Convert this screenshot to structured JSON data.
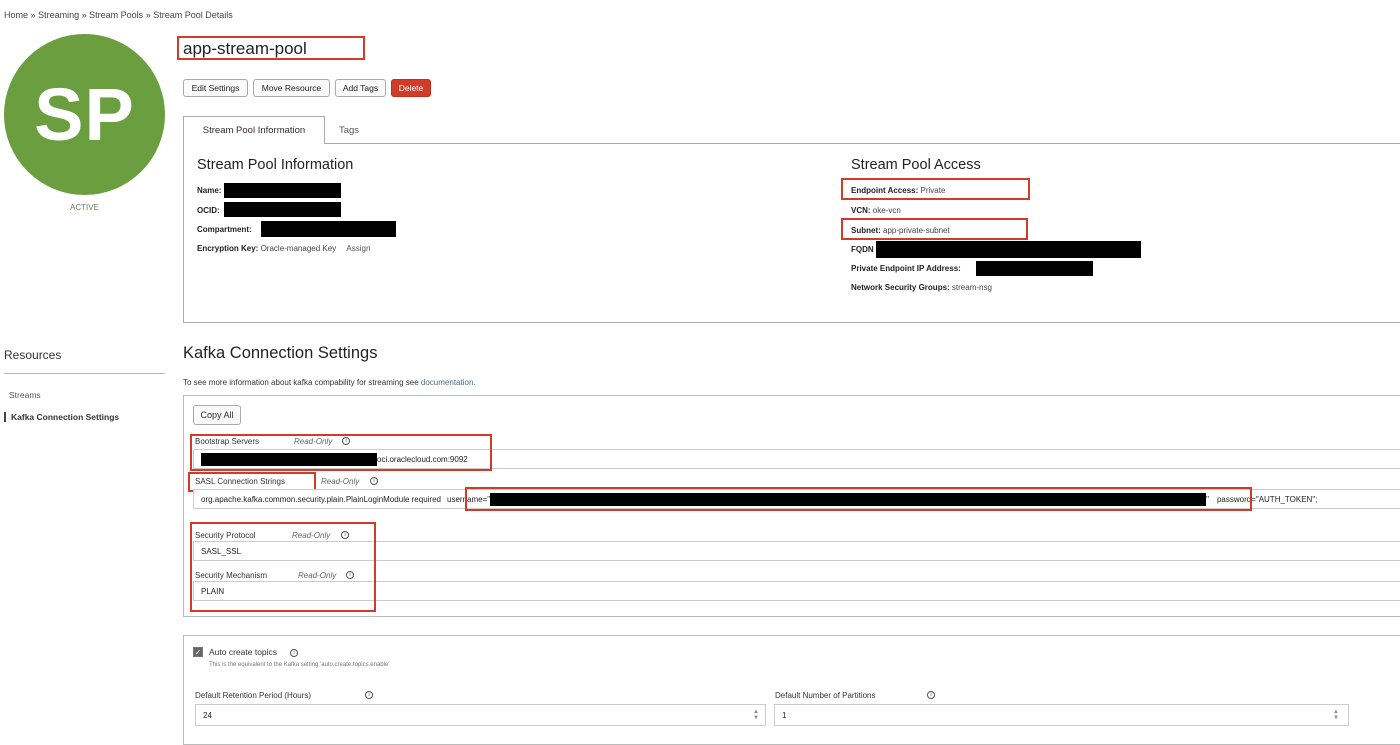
{
  "breadcrumb": [
    "Home",
    "Streaming",
    "Stream Pools",
    "Stream Pool Details"
  ],
  "breadcrumb_sep": "»",
  "avatar": {
    "initials": "SP",
    "status": "ACTIVE",
    "color": "#6a9e3f"
  },
  "title": "app-stream-pool",
  "actions": {
    "edit": "Edit Settings",
    "move": "Move Resource",
    "tags": "Add Tags",
    "delete": "Delete"
  },
  "tabs": {
    "info": "Stream Pool Information",
    "tags": "Tags"
  },
  "info": {
    "heading": "Stream Pool Information",
    "name_label": "Name:",
    "ocid_label": "OCID:",
    "compartment_label": "Compartment:",
    "encryption_label": "Encryption Key:",
    "encryption_value": "Oracle-managed Key",
    "assign": "Assign"
  },
  "access": {
    "heading": "Stream Pool Access",
    "endpoint_label": "Endpoint Access:",
    "endpoint_value": "Private",
    "vcn_label": "VCN:",
    "vcn_value": "oke-vcn",
    "subnet_label": "Subnet:",
    "subnet_value": "app-private-subnet",
    "fqdn_label": "FQDN",
    "pe_ip_label": "Private Endpoint IP Address:",
    "nsg_label": "Network Security Groups:",
    "nsg_value": "stream-nsg"
  },
  "resources": {
    "heading": "Resources",
    "items": [
      "Streams",
      "Kafka Connection Settings"
    ]
  },
  "kafka": {
    "heading": "Kafka Connection Settings",
    "desc": "To see more information about kafka compability for streaming see",
    "desc_link": "documentation",
    "desc_end": ".",
    "copy_all": "Copy All",
    "read_only": "Read-Only",
    "bootstrap_label": "Bootstrap Servers",
    "bootstrap_value_suffix": "oci.oraclecloud.com:9092",
    "sasl_label": "SASL Connection Strings",
    "sasl_prefix": "org.apache.kafka.common.security.plain.PlainLoginModule required",
    "sasl_username": "username=\"",
    "sasl_mid": "\"",
    "sasl_password": "password=\"AUTH_TOKEN\";",
    "protocol_label": "Security Protocol",
    "protocol_value": "SASL_SSL",
    "mechanism_label": "Security Mechanism",
    "mechanism_value": "PLAIN"
  },
  "settings": {
    "auto_create_label": "Auto create topics",
    "auto_create_checked": true,
    "auto_create_help": "This is the equivalent to the Kafka setting 'auto.create.topics.enable'",
    "retention_label": "Default Retention Period (Hours)",
    "retention_value": "24",
    "partitions_label": "Default Number of Partitions",
    "partitions_value": "1"
  },
  "colors": {
    "highlight": "#d13b2a",
    "link": "#4a6b86",
    "delete": "#d13b2a"
  }
}
